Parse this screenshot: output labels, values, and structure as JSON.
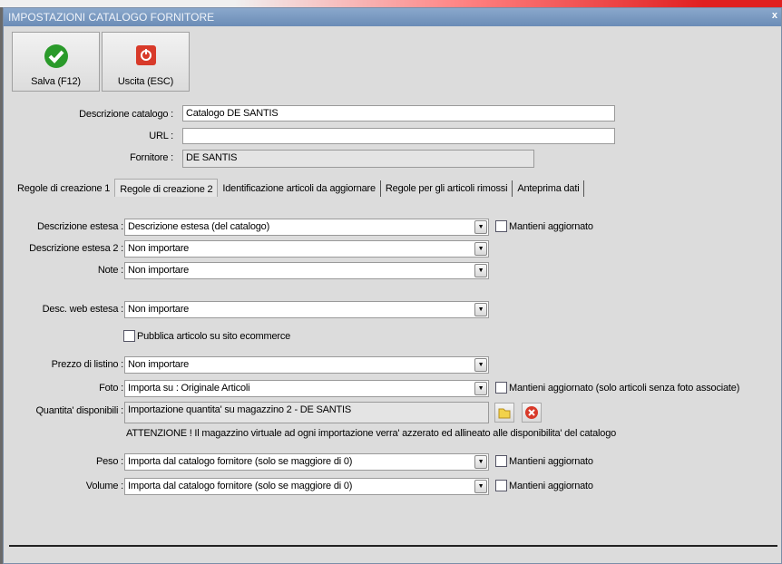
{
  "window": {
    "title": "IMPOSTAZIONI CATALOGO FORNITORE",
    "close": "x"
  },
  "toolbar": {
    "save": "Salva (F12)",
    "exit": "Uscita (ESC)"
  },
  "header": {
    "desc_label": "Descrizione catalogo :",
    "desc_value": "Catalogo DE SANTIS",
    "url_label": "URL :",
    "url_value": "",
    "supplier_label": "Fornitore :",
    "supplier_value": "DE SANTIS"
  },
  "tabs": [
    "Regole di creazione 1",
    "Regole di creazione 2",
    "Identificazione articoli da aggiornare",
    "Regole per gli articoli rimossi",
    "Anteprima dati"
  ],
  "active_tab": 1,
  "form": {
    "desc_estesa": {
      "label": "Descrizione estesa :",
      "value": "Descrizione estesa (del catalogo)",
      "keep": "Mantieni aggiornato"
    },
    "desc_estesa2": {
      "label": "Descrizione estesa 2 :",
      "value": "Non importare"
    },
    "note": {
      "label": "Note :",
      "value": "Non importare"
    },
    "desc_web": {
      "label": "Desc. web estesa :",
      "value": "Non importare"
    },
    "pubblica": "Pubblica articolo su sito ecommerce",
    "prezzo": {
      "label": "Prezzo di listino :",
      "value": "Non importare"
    },
    "foto": {
      "label": "Foto :",
      "value": "Importa su : Originale Articoli",
      "keep": "Mantieni aggiornato (solo articoli senza foto associate)"
    },
    "quantita": {
      "label": "Quantita' disponibili :",
      "value": "Importazione quantita' su magazzino 2 - DE SANTIS"
    },
    "warning": "ATTENZIONE ! Il magazzino virtuale ad ogni importazione verra' azzerato ed allineato alle disponibilita' del catalogo",
    "peso": {
      "label": "Peso :",
      "value": "Importa dal catalogo fornitore (solo se maggiore di 0)",
      "keep": "Mantieni aggiornato"
    },
    "volume": {
      "label": "Volume :",
      "value": "Importa dal catalogo fornitore (solo se maggiore di 0)",
      "keep": "Mantieni aggiornato"
    }
  },
  "colors": {
    "titlebar": "#6b8cb6",
    "save_icon": "#2a9a2a",
    "exit_icon": "#d83a2a"
  }
}
